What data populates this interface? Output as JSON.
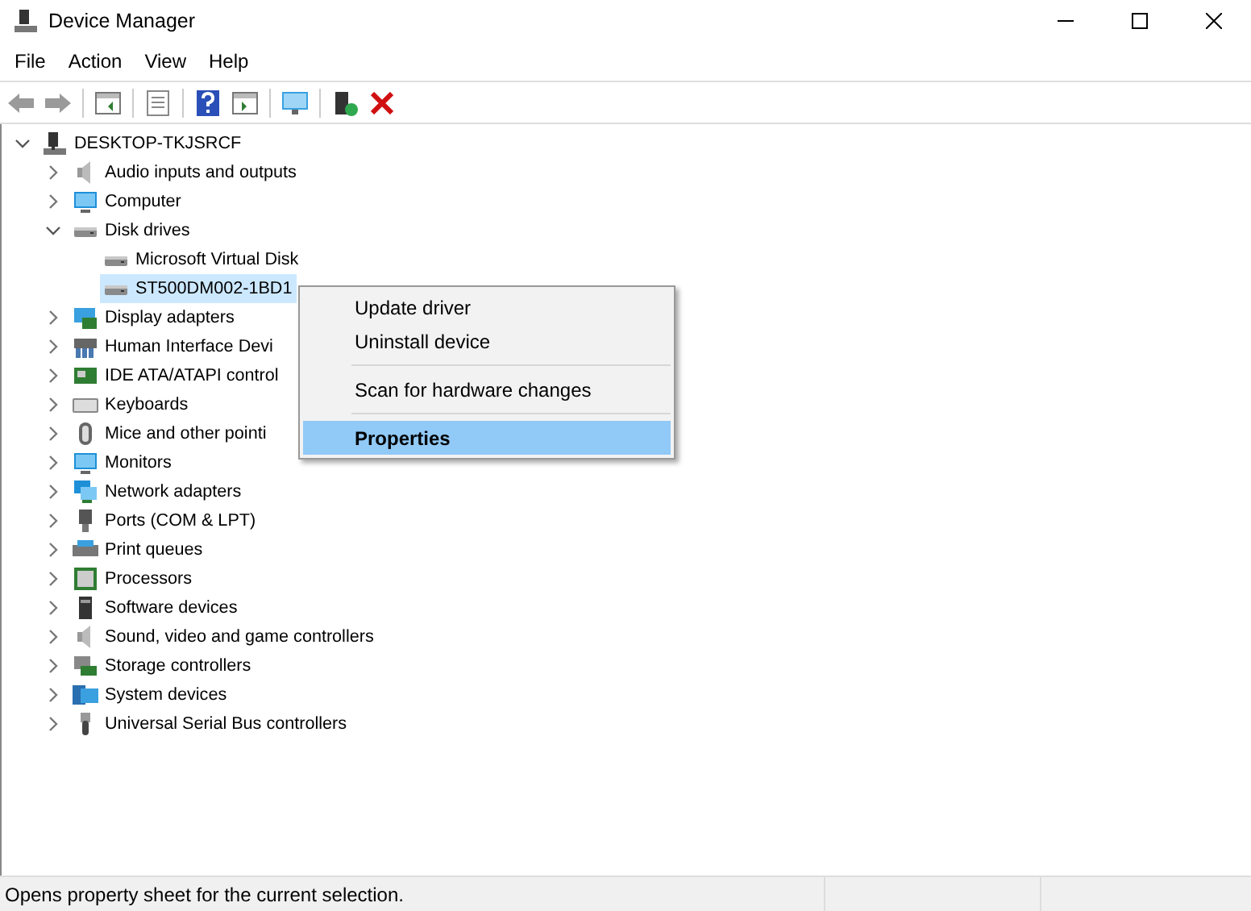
{
  "window": {
    "title": "Device Manager"
  },
  "menu": [
    "File",
    "Action",
    "View",
    "Help"
  ],
  "tree": {
    "label": "DESKTOP-TKJSRCF",
    "kind": "pc",
    "expanded": true,
    "selected": false,
    "children": [
      {
        "label": "Audio inputs and outputs",
        "kind": "speaker",
        "expanded": false,
        "selected": false
      },
      {
        "label": "Computer",
        "kind": "monitor",
        "expanded": false,
        "selected": false
      },
      {
        "label": "Disk drives",
        "kind": "disk",
        "expanded": true,
        "selected": false,
        "children": [
          {
            "label": "Microsoft Virtual Disk",
            "kind": "disk",
            "selected": false
          },
          {
            "label": "ST500DM002-1BD1",
            "kind": "disk",
            "selected": true
          }
        ]
      },
      {
        "label": "Display adapters",
        "kind": "display",
        "expanded": false,
        "selected": false
      },
      {
        "label": "Human Interface Devi",
        "kind": "hid",
        "expanded": false,
        "selected": false
      },
      {
        "label": "IDE ATA/ATAPI control",
        "kind": "card",
        "expanded": false,
        "selected": false
      },
      {
        "label": "Keyboards",
        "kind": "keyboard",
        "expanded": false,
        "selected": false
      },
      {
        "label": "Mice and other pointi",
        "kind": "mouse",
        "expanded": false,
        "selected": false
      },
      {
        "label": "Monitors",
        "kind": "monitor",
        "expanded": false,
        "selected": false
      },
      {
        "label": "Network adapters",
        "kind": "network",
        "expanded": false,
        "selected": false
      },
      {
        "label": "Ports (COM & LPT)",
        "kind": "port",
        "expanded": false,
        "selected": false
      },
      {
        "label": "Print queues",
        "kind": "printer",
        "expanded": false,
        "selected": false
      },
      {
        "label": "Processors",
        "kind": "chip",
        "expanded": false,
        "selected": false
      },
      {
        "label": "Software devices",
        "kind": "tower",
        "expanded": false,
        "selected": false
      },
      {
        "label": "Sound, video and game controllers",
        "kind": "speaker",
        "expanded": false,
        "selected": false
      },
      {
        "label": "Storage controllers",
        "kind": "storage",
        "expanded": false,
        "selected": false
      },
      {
        "label": "System devices",
        "kind": "system",
        "expanded": false,
        "selected": false
      },
      {
        "label": "Universal Serial Bus controllers",
        "kind": "usb",
        "expanded": false,
        "selected": false
      }
    ]
  },
  "context_menu": {
    "groups": [
      [
        {
          "label": "Update driver",
          "selected": false
        },
        {
          "label": "Uninstall device",
          "selected": false
        }
      ],
      [
        {
          "label": "Scan for hardware changes",
          "selected": false
        }
      ],
      [
        {
          "label": "Properties",
          "selected": true
        }
      ]
    ]
  },
  "status_bar": {
    "text": "Opens property sheet for the current selection."
  }
}
